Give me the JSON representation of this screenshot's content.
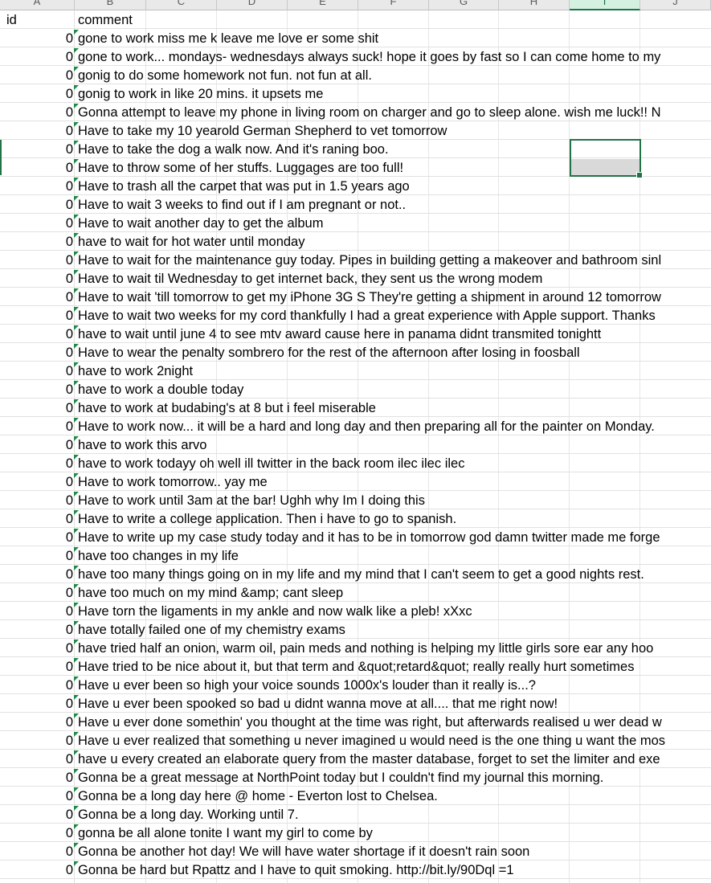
{
  "sheet": {
    "columns": [
      "A",
      "B",
      "C",
      "D",
      "E",
      "F",
      "G",
      "H",
      "I",
      "J"
    ],
    "selected_column": "I",
    "header": {
      "id": "id",
      "comment": "comment"
    },
    "rows": [
      {
        "id": "0",
        "comment": "gone to work miss me k  leave me love er some shit"
      },
      {
        "id": "0",
        "comment": "gone to work... mondays- wednesdays always suck! hope it goes by fast so I can come home to my"
      },
      {
        "id": "0",
        "comment": "gonig to do some homework  not fun. not fun at all."
      },
      {
        "id": "0",
        "comment": "gonig to work in like 20 mins. it upsets me"
      },
      {
        "id": "0",
        "comment": "Gonna attempt to leave my phone in living room on charger and go to sleep alone.  wish me luck!! N"
      },
      {
        "id": "0",
        "comment": "Have to take my 10 yearold German Shepherd to vet tomorrow"
      },
      {
        "id": "0",
        "comment": "Have to take the dog a walk now. And it's raning  boo."
      },
      {
        "id": "0",
        "comment": "Have to throw some of her stuffs. Luggages are too full!"
      },
      {
        "id": "0",
        "comment": "Have to trash all the carpet that was put in 1.5 years ago"
      },
      {
        "id": "0",
        "comment": "Have to wait 3 weeks to find out if I am pregnant or not.."
      },
      {
        "id": "0",
        "comment": "Have to wait another day to get the album"
      },
      {
        "id": "0",
        "comment": "have to wait for hot water until monday"
      },
      {
        "id": "0",
        "comment": "Have to wait for the maintenance guy today. Pipes in building getting a makeover and bathroom sinl"
      },
      {
        "id": "0",
        "comment": "Have to wait til Wednesday to get internet back, they sent us the wrong modem"
      },
      {
        "id": "0",
        "comment": "Have to wait 'till tomorrow to get my iPhone 3G S  They're getting a shipment in around 12 tomorrow"
      },
      {
        "id": "0",
        "comment": "Have to wait two weeks for my cord  thankfully I had a great experience with Apple support. Thanks"
      },
      {
        "id": "0",
        "comment": "have to wait until june 4 to see mtv award cause here in panama didnt transmited tonightt"
      },
      {
        "id": "0",
        "comment": "Have to wear the penalty sombrero for the rest of the afternoon after losing in foosball"
      },
      {
        "id": "0",
        "comment": "have to work 2night"
      },
      {
        "id": "0",
        "comment": "have to work a double today"
      },
      {
        "id": "0",
        "comment": "have to work at budabing's at 8 but i feel miserable"
      },
      {
        "id": "0",
        "comment": "Have to work now... it will be a hard and long day  and then preparing all for the painter on Monday."
      },
      {
        "id": "0",
        "comment": "have to work this arvo"
      },
      {
        "id": "0",
        "comment": "have to work todayy  oh well ill twitter in the back room ilec ilec ilec"
      },
      {
        "id": "0",
        "comment": "Have to work tomorrow.. yay me"
      },
      {
        "id": "0",
        "comment": "Have to work until 3am at the bar! Ughh why Im I doing this"
      },
      {
        "id": "0",
        "comment": "Have to write a college application. Then i have to go to spanish."
      },
      {
        "id": "0",
        "comment": "Have to write up my case study today and it has to be in tomorrow  god damn twitter made me forge"
      },
      {
        "id": "0",
        "comment": "have too changes in my life"
      },
      {
        "id": "0",
        "comment": "have too many things going on in my life and my mind that I can't seem to get a good nights rest."
      },
      {
        "id": "0",
        "comment": "have too much on my mind &amp; cant sleep"
      },
      {
        "id": "0",
        "comment": "Have torn the ligaments in my ankle and now walk like a pleb!  xXxc"
      },
      {
        "id": "0",
        "comment": "have totally failed one of my chemistry exams"
      },
      {
        "id": "0",
        "comment": "have tried half an onion, warm oil, pain meds and nothing is helping my little girls sore ear   any hoo"
      },
      {
        "id": "0",
        "comment": "Have tried to be nice about it, but that term and &quot;retard&quot; really really hurt sometimes"
      },
      {
        "id": "0",
        "comment": "Have u ever been so high your voice sounds 1000x's louder than it really is...?"
      },
      {
        "id": "0",
        "comment": "Have u ever been spooked so bad u didnt wanna move at all.... that me right now!"
      },
      {
        "id": "0",
        "comment": "Have u ever done somethin' you thought at the time was right, but afterwards realised u wer dead w"
      },
      {
        "id": "0",
        "comment": "Have u ever realized that something u never imagined u would need is the one thing u want the mos"
      },
      {
        "id": "0",
        "comment": "have u every created an elaborate query from the master database, forget to set the limiter and exe"
      },
      {
        "id": "0",
        "comment": "Gonna be a great message at NorthPoint today but I couldn't find my journal this morning."
      },
      {
        "id": "0",
        "comment": "Gonna be a long day here @ home - Everton lost to Chelsea."
      },
      {
        "id": "0",
        "comment": "Gonna be a long day. Working until 7."
      },
      {
        "id": "0",
        "comment": "gonna be all alone tonite   I want my girl to come by"
      },
      {
        "id": "0",
        "comment": "Gonna be another hot day! We will have water shortage if it doesn't rain soon"
      },
      {
        "id": "0",
        "comment": "Gonna be hard but Rpattz and I have to quit smoking.    http://bit.ly/90Dql =1"
      }
    ]
  }
}
